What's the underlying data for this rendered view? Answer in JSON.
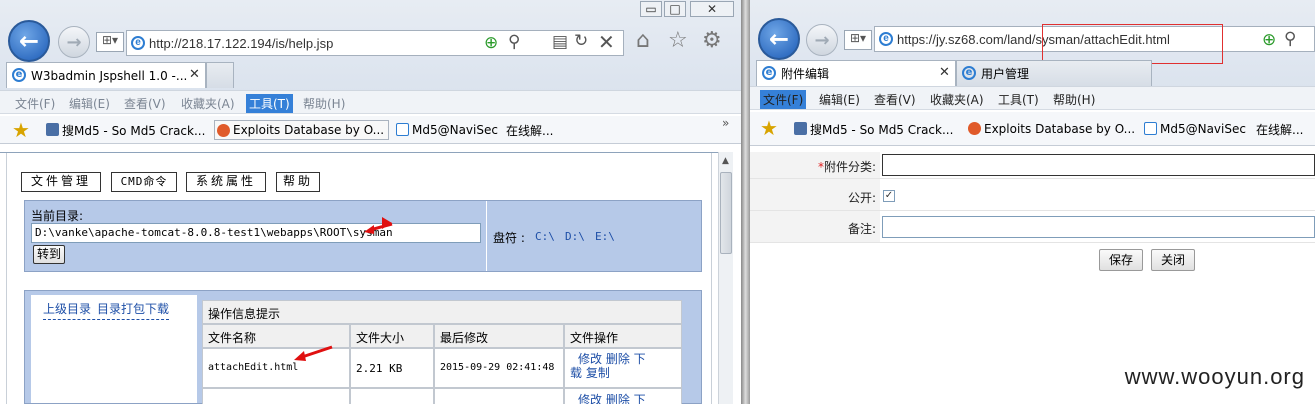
{
  "left": {
    "address_url": "http://218.17.122.194/is/help.jsp",
    "tab_title": "W3badmin Jspshell 1.0 -...",
    "menu": [
      "文件(F)",
      "编辑(E)",
      "查看(V)",
      "收藏夹(A)",
      "工具(T)",
      "帮助(H)"
    ],
    "favorites": [
      "搜Md5 - So Md5 Crack...",
      "Exploits Database by O...",
      "Md5@NaviSec",
      "在线解..."
    ],
    "fav_more": "»",
    "shell": {
      "tabs": [
        "文件管理",
        "CMD命令",
        "系统属性",
        "帮助"
      ],
      "current_dir_label": "当前目录:",
      "current_dir_value": "D:\\vanke\\apache-tomcat-8.0.8-test1\\webapps\\ROOT\\sysman",
      "goto_button": "转到",
      "drives_label": "盘符 :",
      "drives": [
        "C:\\",
        "D:\\",
        "E:\\"
      ],
      "links": [
        "上级目录",
        "目录打包下载"
      ],
      "info_header": "操作信息提示",
      "columns": [
        "文件名称",
        "文件大小",
        "最后修改",
        "文件操作"
      ],
      "rows": [
        {
          "name": "attachEdit.html",
          "size": "2.21 KB",
          "modified": "2015-09-29 02:41:48",
          "ops_line1": "修改 删除 下",
          "ops_line2": "载 复制"
        },
        {
          "name": "",
          "size": "",
          "modified": "",
          "ops_line1": "修改 删除 下",
          "ops_line2": ""
        }
      ]
    }
  },
  "right": {
    "address_url": "https://jy.sz68.com/land/sysman/attachEdit.html",
    "tabs": [
      "附件编辑",
      "用户管理"
    ],
    "menu": [
      "文件(F)",
      "编辑(E)",
      "查看(V)",
      "收藏夹(A)",
      "工具(T)",
      "帮助(H)"
    ],
    "favorites": [
      "搜Md5 - So Md5 Crack...",
      "Exploits Database by O...",
      "Md5@NaviSec",
      "在线解..."
    ],
    "form": {
      "required_mark": "*",
      "category_label": "附件分类:",
      "public_label": "公开:",
      "public_checked": true,
      "remark_label": "备注:",
      "save_button": "保存",
      "close_button": "关闭"
    }
  },
  "watermark": "www.wooyun.org",
  "colors": {
    "accent": "#3580d8",
    "panel": "#b6c9e8",
    "link": "#1e4fa7",
    "arrow": "#e01010"
  }
}
